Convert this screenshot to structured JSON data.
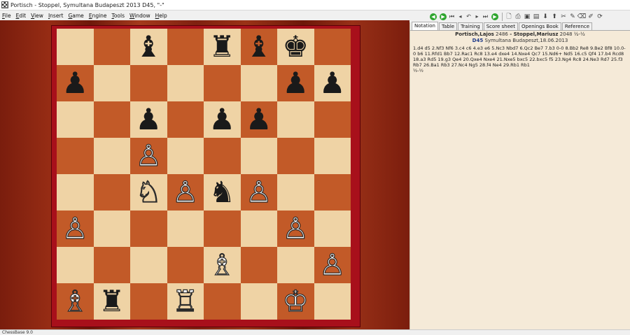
{
  "window": {
    "title": "Portisch - Stoppel, Symultana Budapeszt 2013  D45, \"-\""
  },
  "menu": [
    "File",
    "Edit",
    "View",
    "Insert",
    "Game",
    "Engine",
    "Tools",
    "Window",
    "Help"
  ],
  "toolbar": [
    "play-green-left",
    "play-green-right",
    "first-move",
    "prev-move",
    "undo",
    "next-move",
    "last-move",
    "play-green",
    "new-game",
    "print",
    "save",
    "open",
    "down",
    "up",
    "scissors",
    "pencil",
    "eraser",
    "highlight",
    "refresh"
  ],
  "tabs": [
    "Notation",
    "Table",
    "Training",
    "Score sheet",
    "Openings Book",
    "Reference"
  ],
  "header": {
    "white": "Portisch,Lajos",
    "white_rating": "2486",
    "sep": " - ",
    "black": "Stoppel,Mariusz",
    "black_rating": "2048",
    "result": "½-½",
    "eco": "D45",
    "event": "Symultana Budapeszt",
    "date": "18.06.2013"
  },
  "notation": {
    "moves": [
      "1.d4",
      "d5",
      "2.Nf3",
      "Nf6",
      "3.c4",
      "c6",
      "4.e3",
      "e6",
      "5.Nc3",
      "Nbd7",
      "6.Qc2",
      "Be7",
      "7.b3",
      "0-0",
      "8.Bb2",
      "Re8",
      "9.Be2",
      "Bf8",
      "10.0-0",
      "b6",
      "11.Rfd1",
      "Bb7",
      "12.Rac1",
      "Rc8",
      "13.e4",
      "dxe4",
      "14.Nxe4",
      "Qc7",
      "15.Nd6+",
      "Nd5",
      "16.c5",
      "Qf4",
      "17.b4",
      "Rcd8",
      "18.a3",
      "Rd5",
      "19.g3",
      "Qe4",
      "20.Qxe4",
      "Nxe4",
      "21.Nxe5",
      "bxc5",
      "22.bxc5",
      "f5",
      "23.Ng4",
      "Rc8",
      "24.Ne3",
      "Rd7",
      "25.f3",
      "Rb7",
      "26.Ba1",
      "Rb3",
      "27.Nc4",
      "Ng5",
      "28.f4",
      "Ne4",
      "29.Rb1",
      "Rb1"
    ],
    "current_index": 59,
    "result": "½-½"
  },
  "board": {
    "rows": [
      [
        "",
        "",
        "bB",
        "",
        "bR",
        "bB",
        "bK",
        ""
      ],
      [
        "bP",
        "",
        "",
        "",
        "",
        "",
        "bP",
        "bP"
      ],
      [
        "",
        "",
        "bP",
        "",
        "bP",
        "bP",
        "",
        ""
      ],
      [
        "",
        "",
        "wP",
        "",
        "",
        "",
        "",
        ""
      ],
      [
        "",
        "",
        "wN",
        "wP",
        "bN",
        "wP",
        "",
        ""
      ],
      [
        "wP",
        "",
        "",
        "",
        "",
        "",
        "wP",
        ""
      ],
      [
        "",
        "",
        "",
        "",
        "wB",
        "",
        "",
        "wP"
      ],
      [
        "wB",
        "bR",
        "",
        "wR",
        "",
        "",
        "wK",
        ""
      ]
    ],
    "pieces": {
      "wK": "♔",
      "wQ": "♕",
      "wR": "♖",
      "wB": "♗",
      "wN": "♘",
      "wP": "♙",
      "bK": "♚",
      "bQ": "♛",
      "bR": "♜",
      "bB": "♝",
      "bN": "♞",
      "bP": "♟"
    },
    "light_color": "#efd3a5",
    "dark_color": "#c25a28"
  },
  "status": "ChessBase 9.0"
}
